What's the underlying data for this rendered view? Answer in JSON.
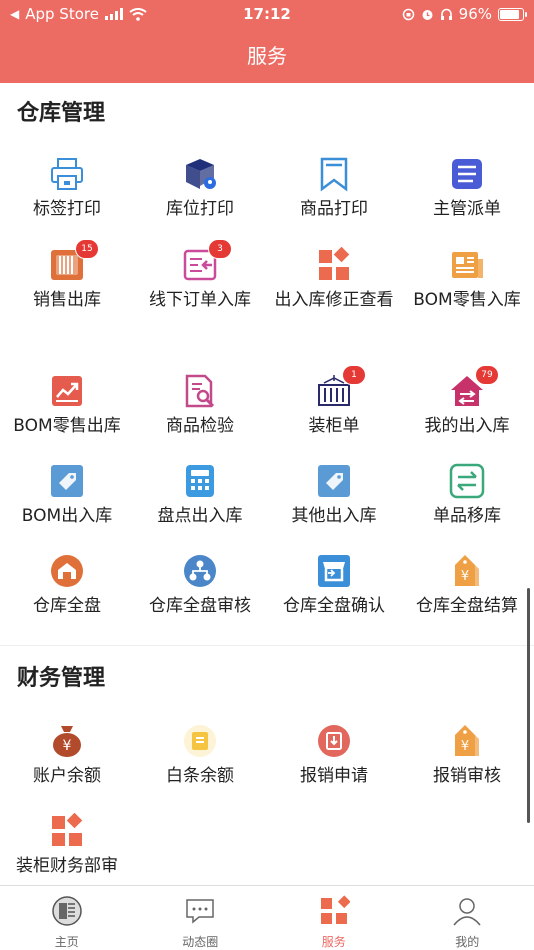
{
  "status_bar": {
    "back_app": "App Store",
    "time": "17:12",
    "battery": "96%"
  },
  "header": {
    "title": "服务"
  },
  "sections": [
    {
      "title": "仓库管理",
      "items": [
        {
          "label": "标签打印",
          "icon": "printer-icon",
          "color": "#3b8ed8"
        },
        {
          "label": "库位打印",
          "icon": "location-box-icon",
          "color": "#1f2f7a"
        },
        {
          "label": "商品打印",
          "icon": "bookmark-icon",
          "color": "#3b8ed8"
        },
        {
          "label": "主管派单",
          "icon": "list-icon",
          "color": "#4a5bd6"
        },
        {
          "label": "销售出库",
          "icon": "radiator-icon",
          "color": "#e0703a",
          "badge": "15"
        },
        {
          "label": "线下订单入库",
          "icon": "order-in-icon",
          "color": "#c94b9a",
          "badge": "3"
        },
        {
          "label": "出入库修正查看",
          "icon": "grid-diamond-icon",
          "color": "#ec6b4f"
        },
        {
          "label": "BOM零售入库",
          "icon": "newspaper-icon",
          "color": "#f0a044"
        },
        {
          "label": "BOM零售出库",
          "icon": "chart-up-icon",
          "color": "#e55b4d"
        },
        {
          "label": "商品检验",
          "icon": "doc-search-icon",
          "color": "#c24a8a"
        },
        {
          "label": "装柜单",
          "icon": "container-icon",
          "color": "#2a2a6a",
          "badge": "1"
        },
        {
          "label": "我的出入库",
          "icon": "home-exchange-icon",
          "color": "#c7326a",
          "badge": "79"
        },
        {
          "label": "BOM出入库",
          "icon": "tag-icon",
          "color": "#5a9bd5"
        },
        {
          "label": "盘点出入库",
          "icon": "calculator-icon",
          "color": "#3b9ae0"
        },
        {
          "label": "其他出入库",
          "icon": "tag-icon",
          "color": "#5a9bd5"
        },
        {
          "label": "单品移库",
          "icon": "swap-icon",
          "color": "#3aa87a"
        },
        {
          "label": "仓库全盘",
          "icon": "warehouse-icon",
          "color": "#e0703a"
        },
        {
          "label": "仓库全盘审核",
          "icon": "hierarchy-icon",
          "color": "#4a86c8"
        },
        {
          "label": "仓库全盘确认",
          "icon": "store-icon",
          "color": "#3b8ed8"
        },
        {
          "label": "仓库全盘结算",
          "icon": "yen-tag-icon",
          "color": "#f0a044"
        }
      ]
    },
    {
      "title": "财务管理",
      "items": [
        {
          "label": "账户余额",
          "icon": "money-bag-icon",
          "color": "#b24a2c"
        },
        {
          "label": "白条余额",
          "icon": "voucher-icon",
          "color": "#f5c542"
        },
        {
          "label": "报销申请",
          "icon": "reimburse-icon",
          "color": "#e2675c"
        },
        {
          "label": "报销审核",
          "icon": "yen-tag-icon",
          "color": "#f0a044"
        },
        {
          "label": "装柜财务部审",
          "icon": "grid-diamond-icon",
          "color": "#ec6b4f"
        }
      ]
    }
  ],
  "tabs": [
    {
      "label": "主页",
      "icon": "home-tab-icon"
    },
    {
      "label": "动态圈",
      "icon": "chat-icon"
    },
    {
      "label": "服务",
      "icon": "service-grid-icon",
      "active": true
    },
    {
      "label": "我的",
      "icon": "user-icon"
    }
  ]
}
